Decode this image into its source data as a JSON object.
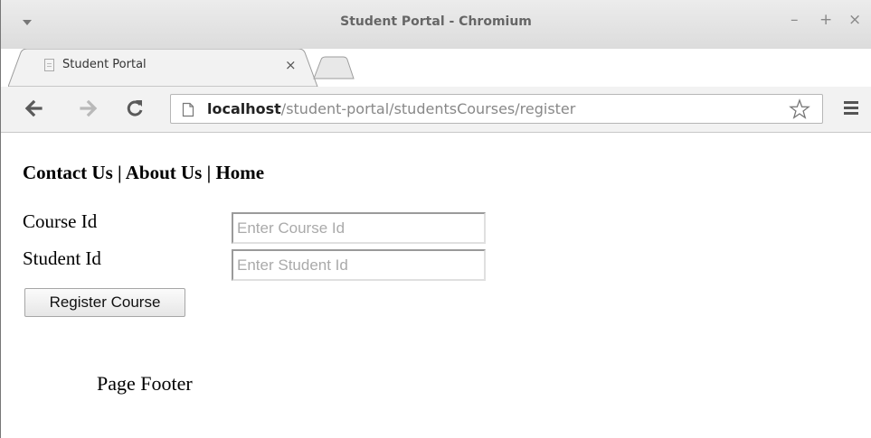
{
  "window": {
    "title": "Student Portal - Chromium",
    "controls": {
      "minimize": "–",
      "maximize": "+",
      "close": "×"
    }
  },
  "tab": {
    "title": "Student Portal",
    "close": "×"
  },
  "address_bar": {
    "host": "localhost",
    "path": "/student-portal/studentsCourses/register"
  },
  "page": {
    "nav": {
      "contact": "Contact Us",
      "about": "About Us",
      "home": "Home",
      "separator": " | "
    },
    "form": {
      "course_label": "Course Id",
      "course_placeholder": "Enter Course Id",
      "course_value": "",
      "student_label": "Student Id",
      "student_placeholder": "Enter Student Id",
      "student_value": "",
      "submit_label": "Register Course"
    },
    "footer": "Page Footer"
  },
  "icons": {
    "menu": "dropdown-arrow-icon",
    "favicon": "page-icon",
    "back": "back-arrow-icon",
    "forward": "forward-arrow-icon",
    "reload": "reload-icon",
    "page_info": "page-icon",
    "bookmark": "star-icon",
    "app_menu": "hamburger-menu-icon"
  },
  "colors": {
    "titlebar": "#e4e4e4",
    "toolbar": "#f2f2f2",
    "url_host": "#222222",
    "url_path": "#888888"
  }
}
